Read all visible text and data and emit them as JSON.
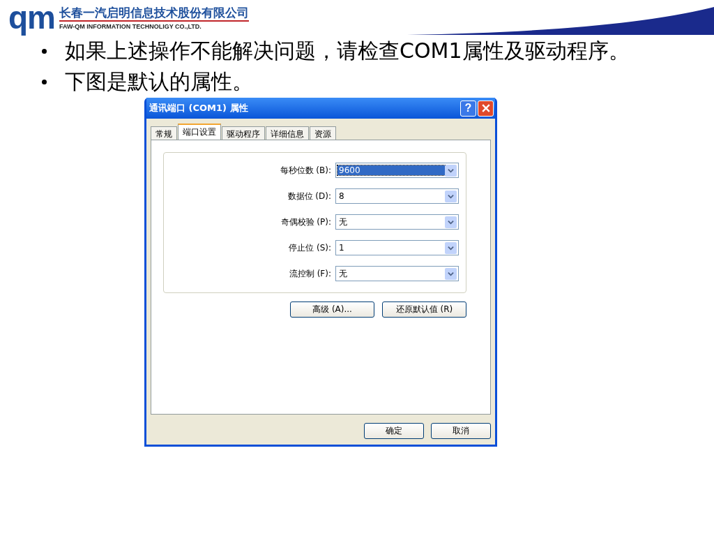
{
  "header": {
    "logo_mark": "qm",
    "company_cn": "长春一汽启明信息技术股份有限公司",
    "company_en": "FAW-QM INFORMATION TECHNOLIGY CO.,LTD."
  },
  "bullets": [
    "如果上述操作不能解决问题，请检查COM1属性及驱动程序。",
    "下图是默认的属性。"
  ],
  "dialog": {
    "title": "通讯端口 (COM1) 属性",
    "help": "?",
    "tabs": [
      {
        "label": "常规",
        "selected": false
      },
      {
        "label": "端口设置",
        "selected": true
      },
      {
        "label": "驱动程序",
        "selected": false
      },
      {
        "label": "详细信息",
        "selected": false
      },
      {
        "label": "资源",
        "selected": false
      }
    ],
    "fields": [
      {
        "label": "每秒位数 (B):",
        "value": "9600",
        "focused": true
      },
      {
        "label": "数据位 (D):",
        "value": "8",
        "focused": false
      },
      {
        "label": "奇偶校验 (P):",
        "value": "无",
        "focused": false
      },
      {
        "label": "停止位 (S):",
        "value": "1",
        "focused": false
      },
      {
        "label": "流控制 (F):",
        "value": "无",
        "focused": false
      }
    ],
    "panel_buttons": [
      "高级 (A)...",
      "还原默认值 (R)"
    ],
    "buttons": [
      "确定",
      "取消"
    ]
  }
}
